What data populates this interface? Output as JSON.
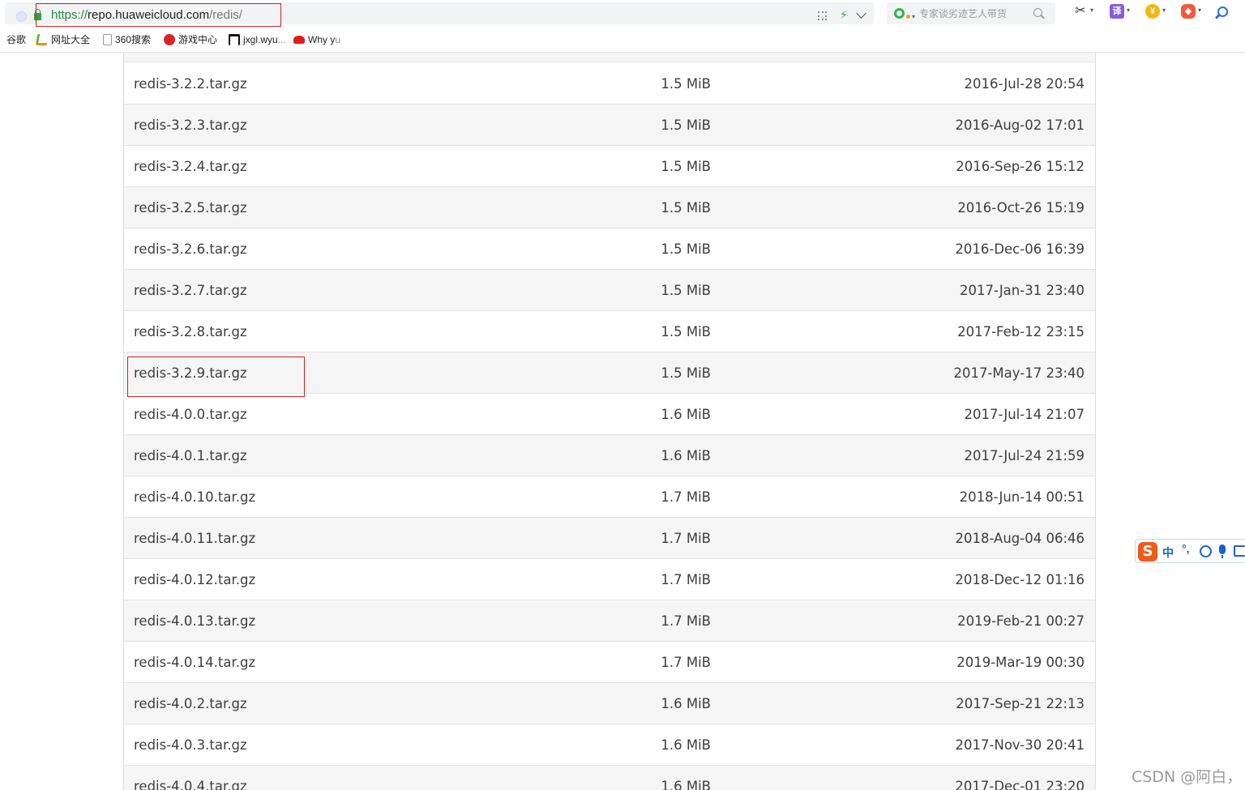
{
  "browser": {
    "url_scheme": "https://",
    "url_host": "repo.huaweicloud.com",
    "url_path": "/redis/",
    "search_placeholder": "专家谈劣迹艺人带货",
    "bolt_glyph": "⚡",
    "scissor_glyph": "✂",
    "translate_glyph": "译",
    "shield_glyph": "¥",
    "game_glyph": "◆",
    "dropdown_glyph": "▾"
  },
  "bookmarks": [
    {
      "label": "谷歌",
      "icon": "google-icon"
    },
    {
      "label": "网址大全",
      "icon": "hao123-icon"
    },
    {
      "label": "360搜索",
      "icon": "page-icon"
    },
    {
      "label": "游戏中心",
      "icon": "game-center-icon"
    },
    {
      "label": "jxgl.wyu",
      "label_fade": "...",
      "icon": "university-icon"
    },
    {
      "label": "Why y",
      "label_fade": "u",
      "icon": "redhat-icon"
    }
  ],
  "listing": {
    "rows": [
      {
        "name": "redis-3.2.2.tar.gz",
        "size": "1.5 MiB",
        "date": "2016-Jul-28 20:54"
      },
      {
        "name": "redis-3.2.3.tar.gz",
        "size": "1.5 MiB",
        "date": "2016-Aug-02 17:01"
      },
      {
        "name": "redis-3.2.4.tar.gz",
        "size": "1.5 MiB",
        "date": "2016-Sep-26 15:12"
      },
      {
        "name": "redis-3.2.5.tar.gz",
        "size": "1.5 MiB",
        "date": "2016-Oct-26 15:19"
      },
      {
        "name": "redis-3.2.6.tar.gz",
        "size": "1.5 MiB",
        "date": "2016-Dec-06 16:39"
      },
      {
        "name": "redis-3.2.7.tar.gz",
        "size": "1.5 MiB",
        "date": "2017-Jan-31 23:40"
      },
      {
        "name": "redis-3.2.8.tar.gz",
        "size": "1.5 MiB",
        "date": "2017-Feb-12 23:15"
      },
      {
        "name": "redis-3.2.9.tar.gz",
        "size": "1.5 MiB",
        "date": "2017-May-17 23:40"
      },
      {
        "name": "redis-4.0.0.tar.gz",
        "size": "1.6 MiB",
        "date": "2017-Jul-14 21:07"
      },
      {
        "name": "redis-4.0.1.tar.gz",
        "size": "1.6 MiB",
        "date": "2017-Jul-24 21:59"
      },
      {
        "name": "redis-4.0.10.tar.gz",
        "size": "1.7 MiB",
        "date": "2018-Jun-14 00:51"
      },
      {
        "name": "redis-4.0.11.tar.gz",
        "size": "1.7 MiB",
        "date": "2018-Aug-04 06:46"
      },
      {
        "name": "redis-4.0.12.tar.gz",
        "size": "1.7 MiB",
        "date": "2018-Dec-12 01:16"
      },
      {
        "name": "redis-4.0.13.tar.gz",
        "size": "1.7 MiB",
        "date": "2019-Feb-21 00:27"
      },
      {
        "name": "redis-4.0.14.tar.gz",
        "size": "1.7 MiB",
        "date": "2019-Mar-19 00:30"
      },
      {
        "name": "redis-4.0.2.tar.gz",
        "size": "1.6 MiB",
        "date": "2017-Sep-21 22:13"
      },
      {
        "name": "redis-4.0.3.tar.gz",
        "size": "1.6 MiB",
        "date": "2017-Nov-30 20:41"
      },
      {
        "name": "redis-4.0.4.tar.gz",
        "size": "1.6 MiB",
        "date": "2017-Dec-01 23:20"
      }
    ]
  },
  "ime": {
    "logo": "S",
    "mode": "中",
    "punct": "°,"
  },
  "watermark": "CSDN @阿白，",
  "colors": {
    "highlight_red": "#d32222",
    "row_alt_bg": "#f5f5f5",
    "url_scheme_green": "#2f8a3c",
    "ime_blue": "#1f5fd4"
  }
}
